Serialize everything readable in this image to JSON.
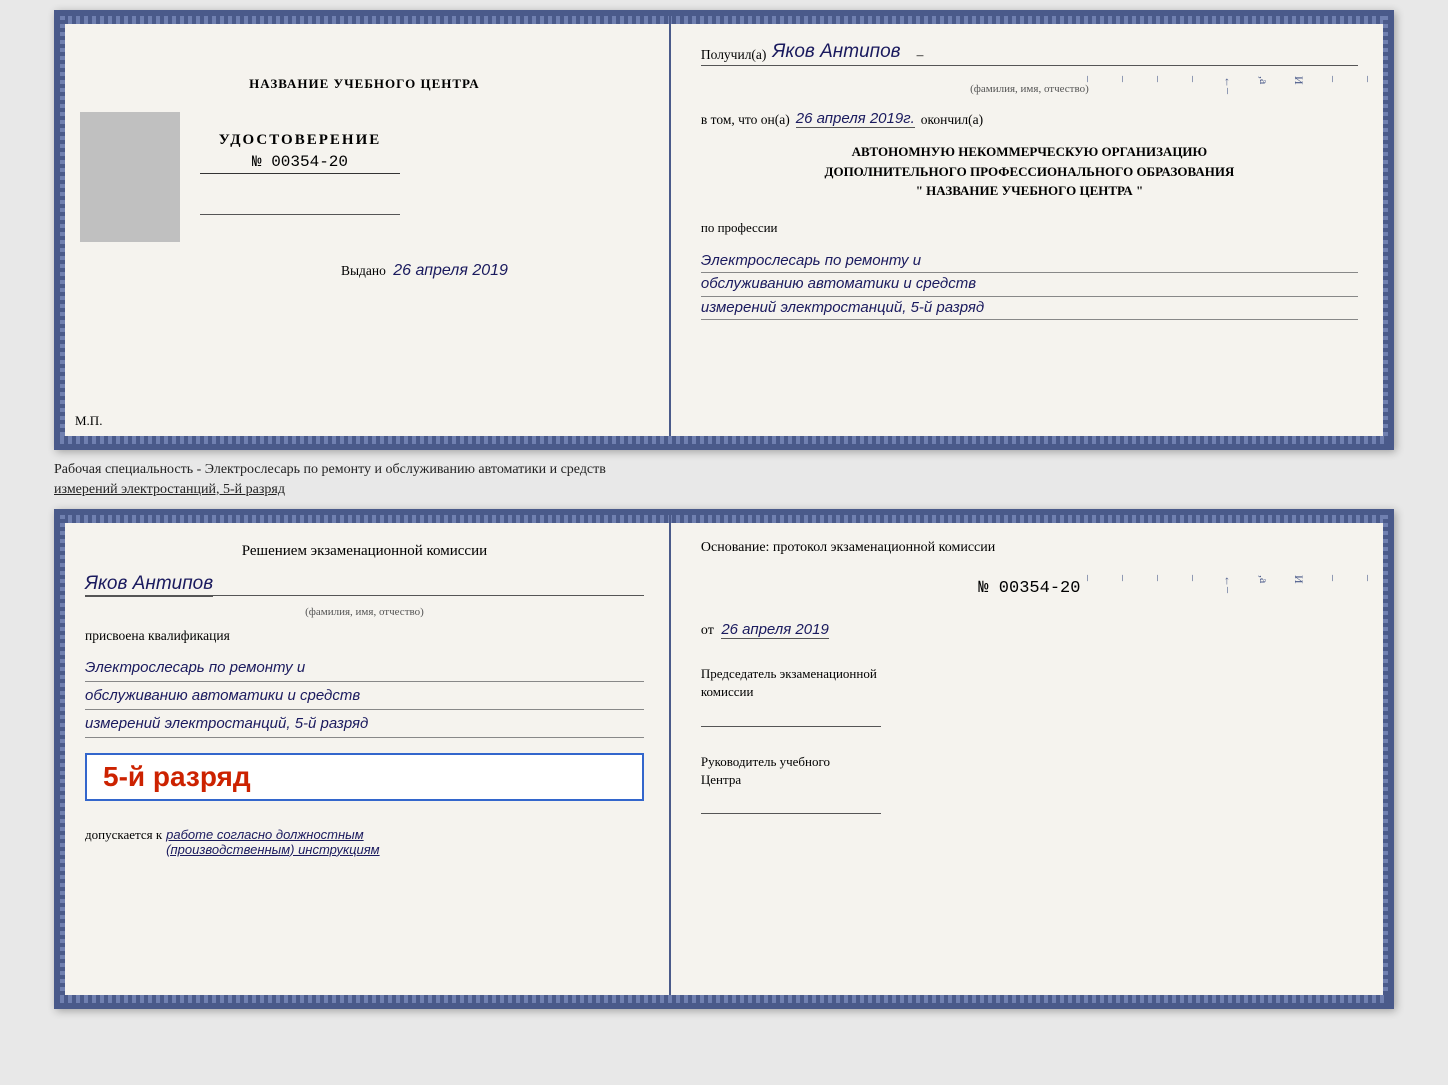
{
  "topDoc": {
    "leftSide": {
      "centerName": "НАЗВАНИЕ УЧЕБНОГО ЦЕНТРА",
      "udostTitle": "УДОСТОВЕРЕНИЕ",
      "udostNumber": "№ 00354-20",
      "vydanoLabel": "Выдано",
      "vydanoDate": "26 апреля 2019",
      "mp": "М.П."
    },
    "rightSide": {
      "poluchilLabel": "Получил(а)",
      "personName": "Яков Антипов",
      "famLabel": "(фамилия, имя, отчество)",
      "vtomLabel": "в том, что он(а)",
      "date": "26 апреля 2019г.",
      "okonchilLabel": "окончил(а)",
      "orgLine1": "АВТОНОМНУЮ НЕКОММЕРЧЕСКУЮ ОРГАНИЗАЦИЮ",
      "orgLine2": "ДОПОЛНИТЕЛЬНОГО ПРОФЕССИОНАЛЬНОГО ОБРАЗОВАНИЯ",
      "orgLine3": "\" НАЗВАНИЕ УЧЕБНОГО ЦЕНТРА \"",
      "proLabel": "по профессии",
      "proLine1": "Электрослесарь по ремонту и",
      "proLine2": "обслуживанию автоматики и средств",
      "proLine3": "измерений электростанций, 5-й разряд"
    }
  },
  "middleText": {
    "line1": "Рабочая специальность - Электрослесарь по ремонту и обслуживанию автоматики и средств",
    "line2": "измерений электростанций, 5-й разряд"
  },
  "bottomDoc": {
    "leftSide": {
      "reshenieTitle": "Решением экзаменационной комиссии",
      "personName": "Яков Антипов",
      "famLabel": "(фамилия, имя, отчество)",
      "prisvoenaLabel": "присвоена квалификация",
      "qualLine1": "Электрослесарь по ремонту и",
      "qualLine2": "обслуживанию автоматики и средств",
      "qualLine3": "измерений электростанций, 5-й разряд",
      "razryadText": "5-й разряд",
      "dopuskLabel": "допускается к",
      "dopuskItalic": "работе согласно должностным",
      "dopuskItalic2": "(производственным) инструкциям"
    },
    "rightSide": {
      "osnovanieLabel": "Основание: протокол экзаменационной комиссии",
      "protokolNumber": "№ 00354-20",
      "otLabel": "от",
      "protokolDate": "26 апреля 2019",
      "predsedatelTitle": "Председатель экзаменационной",
      "komissiiLabel": "комиссии",
      "rukovLabel": "Руководитель учебного",
      "tsentraLabel": "Центра"
    }
  }
}
